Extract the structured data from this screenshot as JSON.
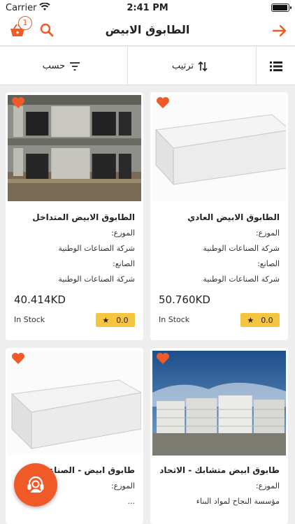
{
  "status_bar": {
    "carrier": "Carrier",
    "time": "2:41 PM",
    "battery_level": 0.95
  },
  "header": {
    "title": "الطابوق الابيض",
    "cart_count": "1"
  },
  "toolbar": {
    "filter_label": "حسب",
    "sort_label": "ترتيب"
  },
  "accent_color": "#f05a28",
  "rating_color": "#f5c542",
  "products": [
    {
      "title": "الطابوق الابيض العادي",
      "distributor_label": "الموزع:",
      "distributor": "شركة الصناعات   الوطنية",
      "manufacturer_label": "الصانع:",
      "manufacturer": "شركة الصناعات الوطنية",
      "price": "50.760KD",
      "stock": "In Stock",
      "rating": "0.0",
      "image": "white-block"
    },
    {
      "title": "الطابوق الابيض المتداخل",
      "distributor_label": "الموزع:",
      "distributor": "شركة الصناعات   الوطنية",
      "manufacturer_label": "الصانع:",
      "manufacturer": "شركة الصناعات الوطنية",
      "price": "40.414KD",
      "stock": "In Stock",
      "rating": "0.0",
      "image": "construction-site"
    },
    {
      "title": "طابوق ابيض متشابك - الاتحاد",
      "distributor_label": "الموزع:",
      "distributor": "مؤسسة النجاح  لمواد البناء",
      "image": "block-pallets"
    },
    {
      "title": "طابوق ابيض - الصناعات",
      "distributor_label": "الموزع:",
      "distributor": "...",
      "image": "white-block"
    }
  ],
  "icons": {
    "cart": "cart-icon",
    "search": "search-icon",
    "back": "arrow-right-icon",
    "filter": "filter-icon",
    "sort": "sort-icon",
    "view": "list-view-icon",
    "favorite": "heart-icon",
    "star": "star-icon",
    "support": "headset-icon"
  }
}
